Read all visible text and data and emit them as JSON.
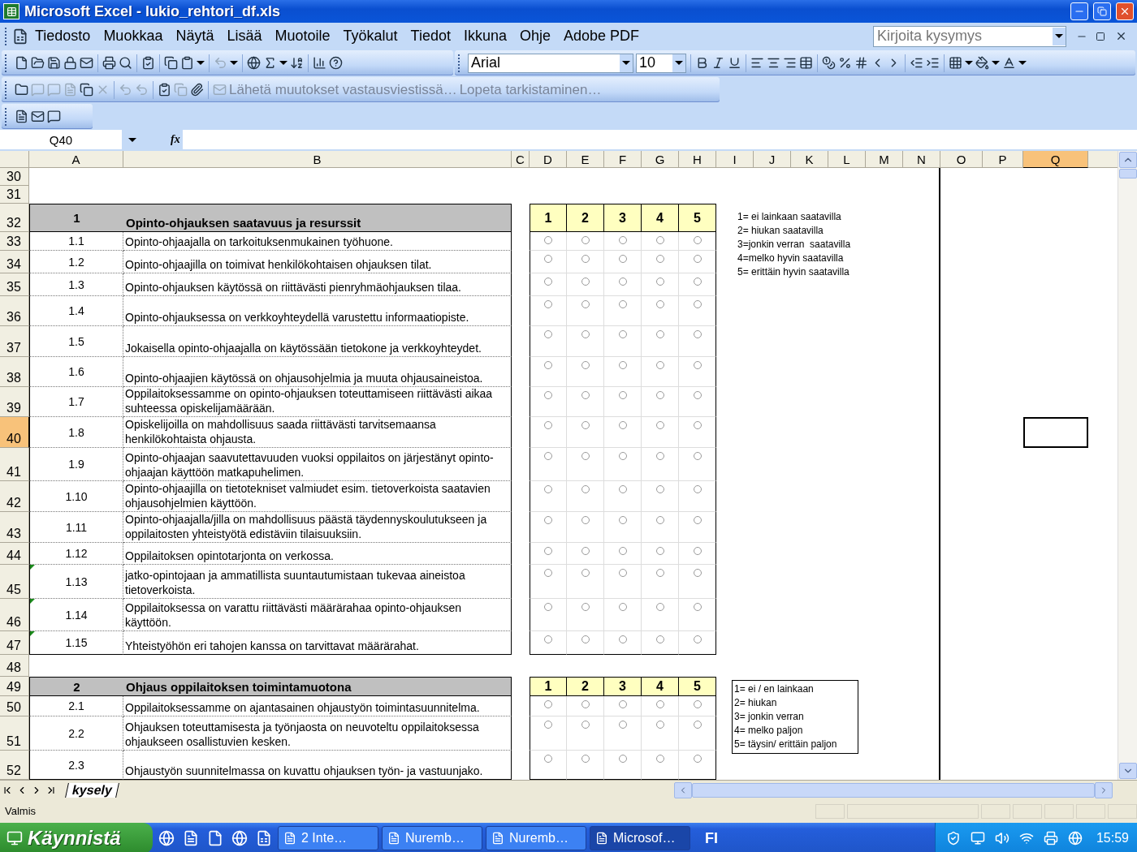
{
  "window": {
    "title": "Microsoft Excel - lukio_rehtori_df.xls"
  },
  "menu": [
    {
      "label": "Tiedosto"
    },
    {
      "label": "Muokkaa"
    },
    {
      "label": "Näytä"
    },
    {
      "label": "Lisää"
    },
    {
      "label": "Muotoile"
    },
    {
      "label": "Työkalut"
    },
    {
      "label": "Tiedot"
    },
    {
      "label": "Ikkuna"
    },
    {
      "label": "Ohje"
    },
    {
      "label": "Adobe PDF"
    }
  ],
  "help_box": {
    "placeholder": "Kirjoita kysymys"
  },
  "format_toolbar": {
    "font": "Arial",
    "size": "10"
  },
  "review_toolbar": [
    {
      "label": "Lähetä muutokset vastausviestissä…",
      "disabled": true
    },
    {
      "label": "Lopeta tarkistaminen…",
      "disabled": true
    }
  ],
  "formula_bar": {
    "name_box": "Q40",
    "fx_label": "fx"
  },
  "columns": [
    {
      "label": "A",
      "selected": false
    },
    {
      "label": "B",
      "selected": false
    },
    {
      "label": "C",
      "selected": false
    },
    {
      "label": "D",
      "selected": false
    },
    {
      "label": "E",
      "selected": false
    },
    {
      "label": "F",
      "selected": false
    },
    {
      "label": "G",
      "selected": false
    },
    {
      "label": "H",
      "selected": false
    },
    {
      "label": "I",
      "selected": false
    },
    {
      "label": "J",
      "selected": false
    },
    {
      "label": "K",
      "selected": false
    },
    {
      "label": "L",
      "selected": false
    },
    {
      "label": "M",
      "selected": false
    },
    {
      "label": "N",
      "selected": false
    },
    {
      "label": "O",
      "selected": false
    },
    {
      "label": "P",
      "selected": false
    },
    {
      "label": "Q",
      "selected": true
    }
  ],
  "rows": [
    {
      "number": "30",
      "kind": "blank",
      "selected": false
    },
    {
      "number": "31",
      "kind": "blank",
      "selected": false
    },
    {
      "number": "32",
      "kind": "section",
      "selected": false,
      "code": "1",
      "title": "Opinto-ohjauksen saatavuus ja resurssit",
      "scale": [
        "1",
        "2",
        "3",
        "4",
        "5"
      ],
      "legend": {
        "boxed": false,
        "lines": [
          "1= ei lainkaan saatavilla",
          "2= hiukan saatavilla",
          "3=jonkin verran  saatavilla",
          "4=melko hyvin saatavilla",
          "5= erittäin hyvin saatavilla"
        ]
      }
    },
    {
      "number": "33",
      "kind": "item",
      "selected": false,
      "flagged": false,
      "code": "1.1",
      "text": "Opinto-ohjaajalla on tarkoituksenmukainen työhuone.",
      "options": [
        {
          "selected": false
        },
        {
          "selected": false
        },
        {
          "selected": false
        },
        {
          "selected": false
        },
        {
          "selected": false
        }
      ]
    },
    {
      "number": "34",
      "kind": "item",
      "selected": false,
      "flagged": false,
      "code": "1.2",
      "text": "Opinto-ohjaajilla on toimivat henkilökohtaisen ohjauksen tilat.",
      "options": [
        {
          "selected": false
        },
        {
          "selected": false
        },
        {
          "selected": false
        },
        {
          "selected": false
        },
        {
          "selected": false
        }
      ]
    },
    {
      "number": "35",
      "kind": "item",
      "selected": false,
      "flagged": false,
      "code": "1.3",
      "text": "Opinto-ohjauksen käytössä on riittävästi pienryhmäohjauksen tilaa.",
      "options": [
        {
          "selected": false
        },
        {
          "selected": false
        },
        {
          "selected": false
        },
        {
          "selected": false
        },
        {
          "selected": false
        }
      ]
    },
    {
      "number": "36",
      "kind": "item",
      "selected": false,
      "flagged": false,
      "code": "1.4",
      "text": "Opinto-ohjauksessa on verkkoyhteydellä varustettu informaatiopiste.",
      "options": [
        {
          "selected": false
        },
        {
          "selected": false
        },
        {
          "selected": false
        },
        {
          "selected": false
        },
        {
          "selected": false
        }
      ]
    },
    {
      "number": "37",
      "kind": "item",
      "selected": false,
      "flagged": false,
      "code": "1.5",
      "text": "Jokaisella opinto-ohjaajalla on käytössään tietokone ja verkkoyhteydet.",
      "options": [
        {
          "selected": false
        },
        {
          "selected": false
        },
        {
          "selected": false
        },
        {
          "selected": false
        },
        {
          "selected": false
        }
      ]
    },
    {
      "number": "38",
      "kind": "item",
      "selected": false,
      "flagged": false,
      "code": "1.6",
      "text": "Opinto-ohjaajien käytössä on ohjausohjelmia ja muuta ohjausaineistoa.",
      "options": [
        {
          "selected": false
        },
        {
          "selected": false
        },
        {
          "selected": false
        },
        {
          "selected": false
        },
        {
          "selected": false
        }
      ]
    },
    {
      "number": "39",
      "kind": "item",
      "selected": false,
      "flagged": false,
      "code": "1.7",
      "text": "Oppilaitoksessamme on opinto-ohjauksen toteuttamiseen riittävästi aikaa suhteessa opiskelijamäärään.",
      "options": [
        {
          "selected": false
        },
        {
          "selected": false
        },
        {
          "selected": false
        },
        {
          "selected": false
        },
        {
          "selected": false
        }
      ]
    },
    {
      "number": "40",
      "kind": "item",
      "selected": true,
      "flagged": false,
      "code": "1.8",
      "text": "Opiskelijoilla on mahdollisuus saada riittävästi tarvitsemaansa henkilökohtaista ohjausta.",
      "options": [
        {
          "selected": false
        },
        {
          "selected": false
        },
        {
          "selected": false
        },
        {
          "selected": false
        },
        {
          "selected": false
        }
      ]
    },
    {
      "number": "41",
      "kind": "item",
      "selected": false,
      "flagged": false,
      "code": "1.9",
      "text": "Opinto-ohjaajan saavutettavuuden vuoksi oppilaitos on järjestänyt opinto-ohjaajan käyttöön matkapuhelimen.",
      "options": [
        {
          "selected": false
        },
        {
          "selected": false
        },
        {
          "selected": false
        },
        {
          "selected": false
        },
        {
          "selected": false
        }
      ]
    },
    {
      "number": "42",
      "kind": "item",
      "selected": false,
      "flagged": false,
      "code": "1.10",
      "text": "Opinto-ohjaajilla on tietotekniset valmiudet esim. tietoverkoista saatavien ohjausohjelmien käyttöön.",
      "options": [
        {
          "selected": false
        },
        {
          "selected": false
        },
        {
          "selected": false
        },
        {
          "selected": false
        },
        {
          "selected": false
        }
      ]
    },
    {
      "number": "43",
      "kind": "item",
      "selected": false,
      "flagged": false,
      "code": "1.11",
      "text": "Opinto-ohjaajalla/jilla on mahdollisuus päästä täydennyskoulutukseen ja oppilaitosten yhteistyötä edistäviin tilaisuuksiin.",
      "options": [
        {
          "selected": false
        },
        {
          "selected": false
        },
        {
          "selected": false
        },
        {
          "selected": false
        },
        {
          "selected": false
        }
      ]
    },
    {
      "number": "44",
      "kind": "item",
      "selected": false,
      "flagged": false,
      "code": "1.12",
      "text": "Oppilaitoksen opintotarjonta on verkossa.",
      "options": [
        {
          "selected": false
        },
        {
          "selected": false
        },
        {
          "selected": false
        },
        {
          "selected": false
        },
        {
          "selected": false
        }
      ]
    },
    {
      "number": "45",
      "kind": "item",
      "selected": false,
      "flagged": true,
      "code": "1.13",
      "text": "jatko-opintojaan ja ammatillista suuntautumistaan tukevaa aineistoa tietoverkoista.",
      "options": [
        {
          "selected": false
        },
        {
          "selected": false
        },
        {
          "selected": false
        },
        {
          "selected": false
        },
        {
          "selected": false
        }
      ]
    },
    {
      "number": "46",
      "kind": "item",
      "selected": false,
      "flagged": true,
      "code": "1.14",
      "text": "Oppilaitoksessa on varattu riittävästi määrärahaa opinto-ohjauksen käyttöön.",
      "options": [
        {
          "selected": false
        },
        {
          "selected": false
        },
        {
          "selected": false
        },
        {
          "selected": false
        },
        {
          "selected": false
        }
      ]
    },
    {
      "number": "47",
      "kind": "item",
      "selected": false,
      "flagged": true,
      "code": "1.15",
      "text": "Yhteistyöhön eri tahojen kanssa on tarvittavat määrärahat.",
      "options": [
        {
          "selected": false
        },
        {
          "selected": false
        },
        {
          "selected": false
        },
        {
          "selected": false
        },
        {
          "selected": false
        }
      ]
    },
    {
      "number": "48",
      "kind": "blank",
      "selected": false
    },
    {
      "number": "49",
      "kind": "section",
      "selected": false,
      "code": "2",
      "title": "Ohjaus oppilaitoksen toimintamuotona",
      "scale": [
        "1",
        "2",
        "3",
        "4",
        "5"
      ],
      "legend": {
        "boxed": true,
        "lines": [
          "1= ei / en lainkaan",
          "2= hiukan",
          "3= jonkin verran",
          "4= melko paljon",
          "5= täysin/ erittäin paljon"
        ]
      }
    },
    {
      "number": "50",
      "kind": "item",
      "selected": false,
      "flagged": false,
      "code": "2.1",
      "text": "Oppilaitoksessamme on ajantasainen ohjaustyön toimintasuunnitelma.",
      "options": [
        {
          "selected": false
        },
        {
          "selected": false
        },
        {
          "selected": false
        },
        {
          "selected": false
        },
        {
          "selected": false
        }
      ]
    },
    {
      "number": "51",
      "kind": "item",
      "selected": false,
      "flagged": false,
      "code": "2.2",
      "text": "Ohjauksen toteuttamisesta ja työnjaosta on neuvoteltu oppilaitoksessa ohjaukseen osallistuvien kesken.",
      "options": [
        {
          "selected": false
        },
        {
          "selected": false
        },
        {
          "selected": false
        },
        {
          "selected": false
        },
        {
          "selected": false
        }
      ]
    },
    {
      "number": "52",
      "kind": "item",
      "selected": false,
      "flagged": false,
      "code": "2.3",
      "text": "Ohjaustyön suunnitelmassa on kuvattu ohjauksen työn- ja vastuunjako.",
      "options": [
        {
          "selected": false
        },
        {
          "selected": false
        },
        {
          "selected": false
        },
        {
          "selected": false
        },
        {
          "selected": false
        }
      ]
    }
  ],
  "sheet_tabs": [
    {
      "label": "kysely",
      "selected": true
    }
  ],
  "status_bar": {
    "text": "Valmis"
  },
  "taskbar": {
    "start": "Käynnistä",
    "tasks": [
      {
        "label": "2 Inte…",
        "selected": false
      },
      {
        "label": "Nuremb…",
        "selected": false
      },
      {
        "label": "Nuremb…",
        "selected": false
      },
      {
        "label": "Microsof…",
        "selected": true
      }
    ],
    "language": "FI",
    "clock": "15:59"
  }
}
